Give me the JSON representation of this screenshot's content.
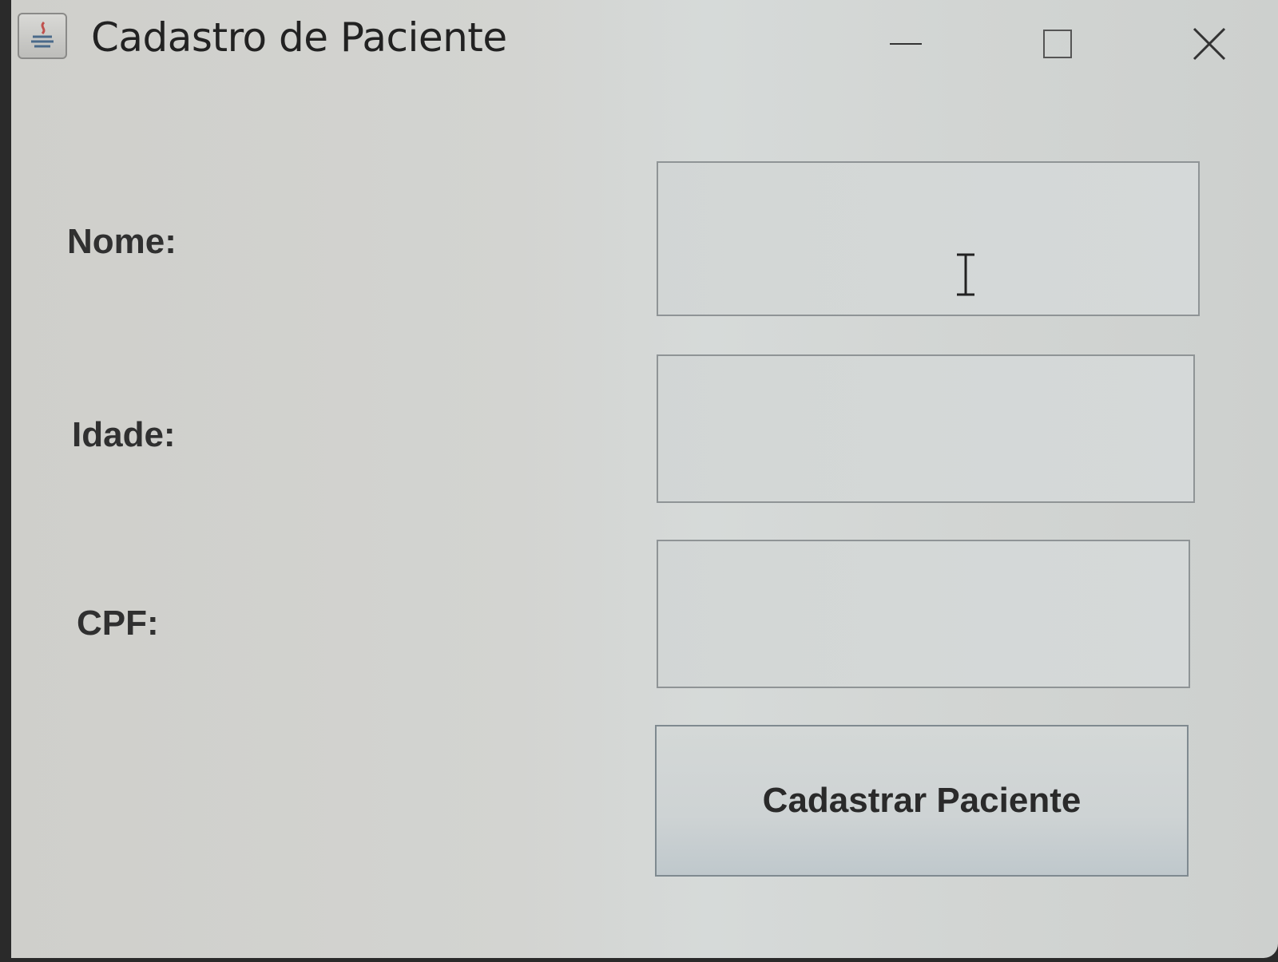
{
  "window": {
    "title": "Cadastro de Paciente",
    "icon": "java-icon"
  },
  "titlebar_controls": {
    "minimize": "minimize-icon",
    "maximize": "maximize-icon",
    "close": "close-icon"
  },
  "form": {
    "nome_label": "Nome:",
    "nome_value": "",
    "idade_label": "Idade:",
    "idade_value": "",
    "cpf_label": "CPF:",
    "cpf_value": "",
    "submit_label": "Cadastrar Paciente"
  },
  "pointer": {
    "icon": "text-cursor-icon"
  }
}
